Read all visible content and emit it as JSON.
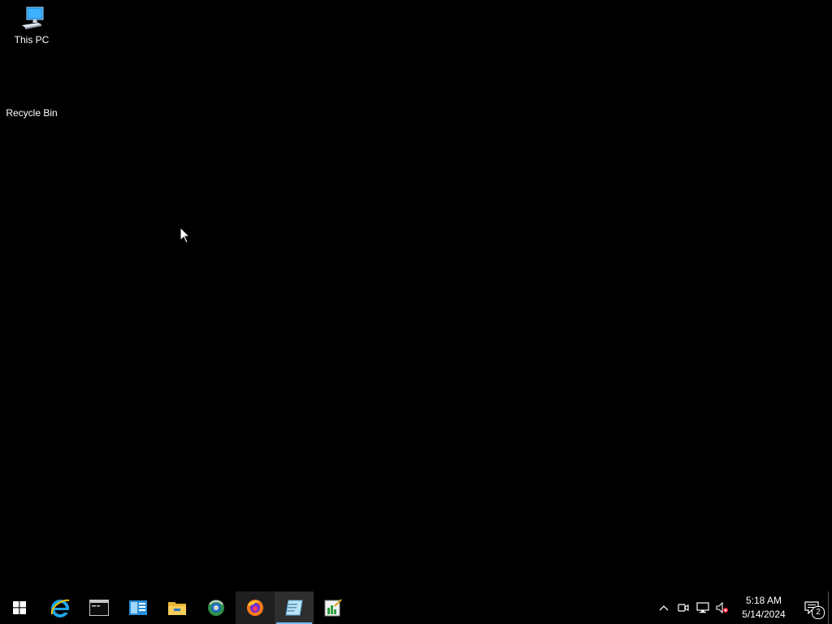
{
  "desktop": {
    "icons": [
      {
        "label": "This PC",
        "icon": "this-pc-icon"
      },
      {
        "label": "Recycle Bin",
        "icon": "recycle-bin-icon"
      }
    ]
  },
  "taskbar": {
    "start_icon": "windows-start-icon",
    "apps": [
      {
        "icon": "internet-explorer-icon",
        "state": "normal"
      },
      {
        "icon": "command-prompt-icon",
        "state": "normal"
      },
      {
        "icon": "server-manager-icon",
        "state": "normal"
      },
      {
        "icon": "file-explorer-icon",
        "state": "normal"
      },
      {
        "icon": "network-globe-icon",
        "state": "normal"
      },
      {
        "icon": "firefox-icon",
        "state": "highlight"
      },
      {
        "icon": "notepad-icon",
        "state": "active"
      },
      {
        "icon": "chart-editor-icon",
        "state": "normal"
      }
    ],
    "tray": {
      "icons": [
        "chevron-up-icon",
        "meet-now-icon",
        "network-icon",
        "volume-muted-icon"
      ],
      "time": "5:18 AM",
      "date": "5/14/2024",
      "notification_count": "2"
    }
  },
  "colors": {
    "background": "#000000",
    "accent": "#76b9ed",
    "text": "#ffffff"
  }
}
